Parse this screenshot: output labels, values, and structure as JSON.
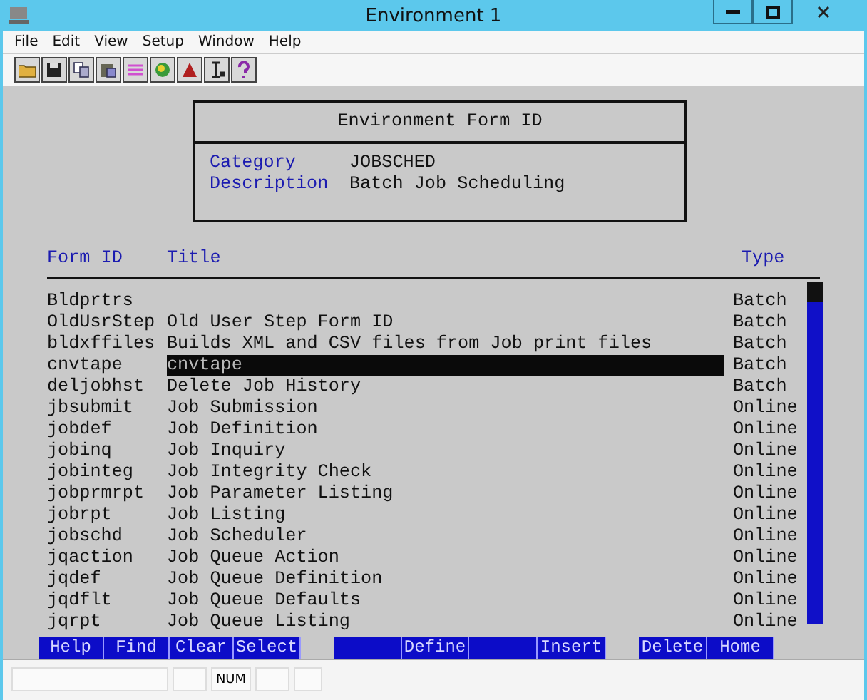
{
  "window": {
    "title": "Environment 1"
  },
  "menu": [
    "File",
    "Edit",
    "View",
    "Setup",
    "Window",
    "Help"
  ],
  "header_box": {
    "title": "Environment Form ID",
    "fields": [
      {
        "label": "Category",
        "value": "JOBSCHED"
      },
      {
        "label": "Description",
        "value": "Batch Job Scheduling"
      }
    ]
  },
  "table": {
    "columns": [
      "Form ID",
      "Title",
      "Type"
    ],
    "rows": [
      {
        "form_id": "Bldprtrs",
        "title": "",
        "type": "Batch",
        "selected": false
      },
      {
        "form_id": "OldUsrStep",
        "title": "Old User Step Form ID",
        "type": "Batch",
        "selected": false
      },
      {
        "form_id": "bldxffiles",
        "title": "Builds XML and CSV files from Job print files",
        "type": "Batch",
        "selected": false
      },
      {
        "form_id": "cnvtape",
        "title": "cnvtape",
        "type": "Batch",
        "selected": true
      },
      {
        "form_id": "deljobhst",
        "title": "Delete Job History",
        "type": "Batch",
        "selected": false
      },
      {
        "form_id": "jbsubmit",
        "title": "Job Submission",
        "type": "Online",
        "selected": false
      },
      {
        "form_id": "jobdef",
        "title": "Job Definition",
        "type": "Online",
        "selected": false
      },
      {
        "form_id": "jobinq",
        "title": "Job Inquiry",
        "type": "Online",
        "selected": false
      },
      {
        "form_id": "jobinteg",
        "title": "Job Integrity Check",
        "type": "Online",
        "selected": false
      },
      {
        "form_id": "jobprmrpt",
        "title": "Job Parameter Listing",
        "type": "Online",
        "selected": false
      },
      {
        "form_id": "jobrpt",
        "title": "Job Listing",
        "type": "Online",
        "selected": false
      },
      {
        "form_id": "jobschd",
        "title": "Job Scheduler",
        "type": "Online",
        "selected": false
      },
      {
        "form_id": "jqaction",
        "title": "Job Queue Action",
        "type": "Online",
        "selected": false
      },
      {
        "form_id": "jqdef",
        "title": "Job Queue Definition",
        "type": "Online",
        "selected": false
      },
      {
        "form_id": "jqdflt",
        "title": "Job Queue Defaults",
        "type": "Online",
        "selected": false
      },
      {
        "form_id": "jqrpt",
        "title": "Job Queue Listing",
        "type": "Online",
        "selected": false
      }
    ]
  },
  "function_keys": [
    [
      {
        "kind": "key",
        "label": "Help"
      },
      {
        "kind": "key",
        "label": "Find"
      },
      {
        "kind": "key",
        "label": "Clear"
      },
      {
        "kind": "key",
        "label": "Select"
      }
    ],
    [
      {
        "kind": "blank"
      },
      {
        "kind": "key",
        "label": "Define"
      },
      {
        "kind": "blank"
      },
      {
        "kind": "key",
        "label": "Insert"
      }
    ],
    [
      {
        "kind": "key",
        "label": "Delete"
      },
      {
        "kind": "key",
        "label": "Home"
      }
    ]
  ],
  "status_bar": {
    "indicator": "NUM"
  }
}
